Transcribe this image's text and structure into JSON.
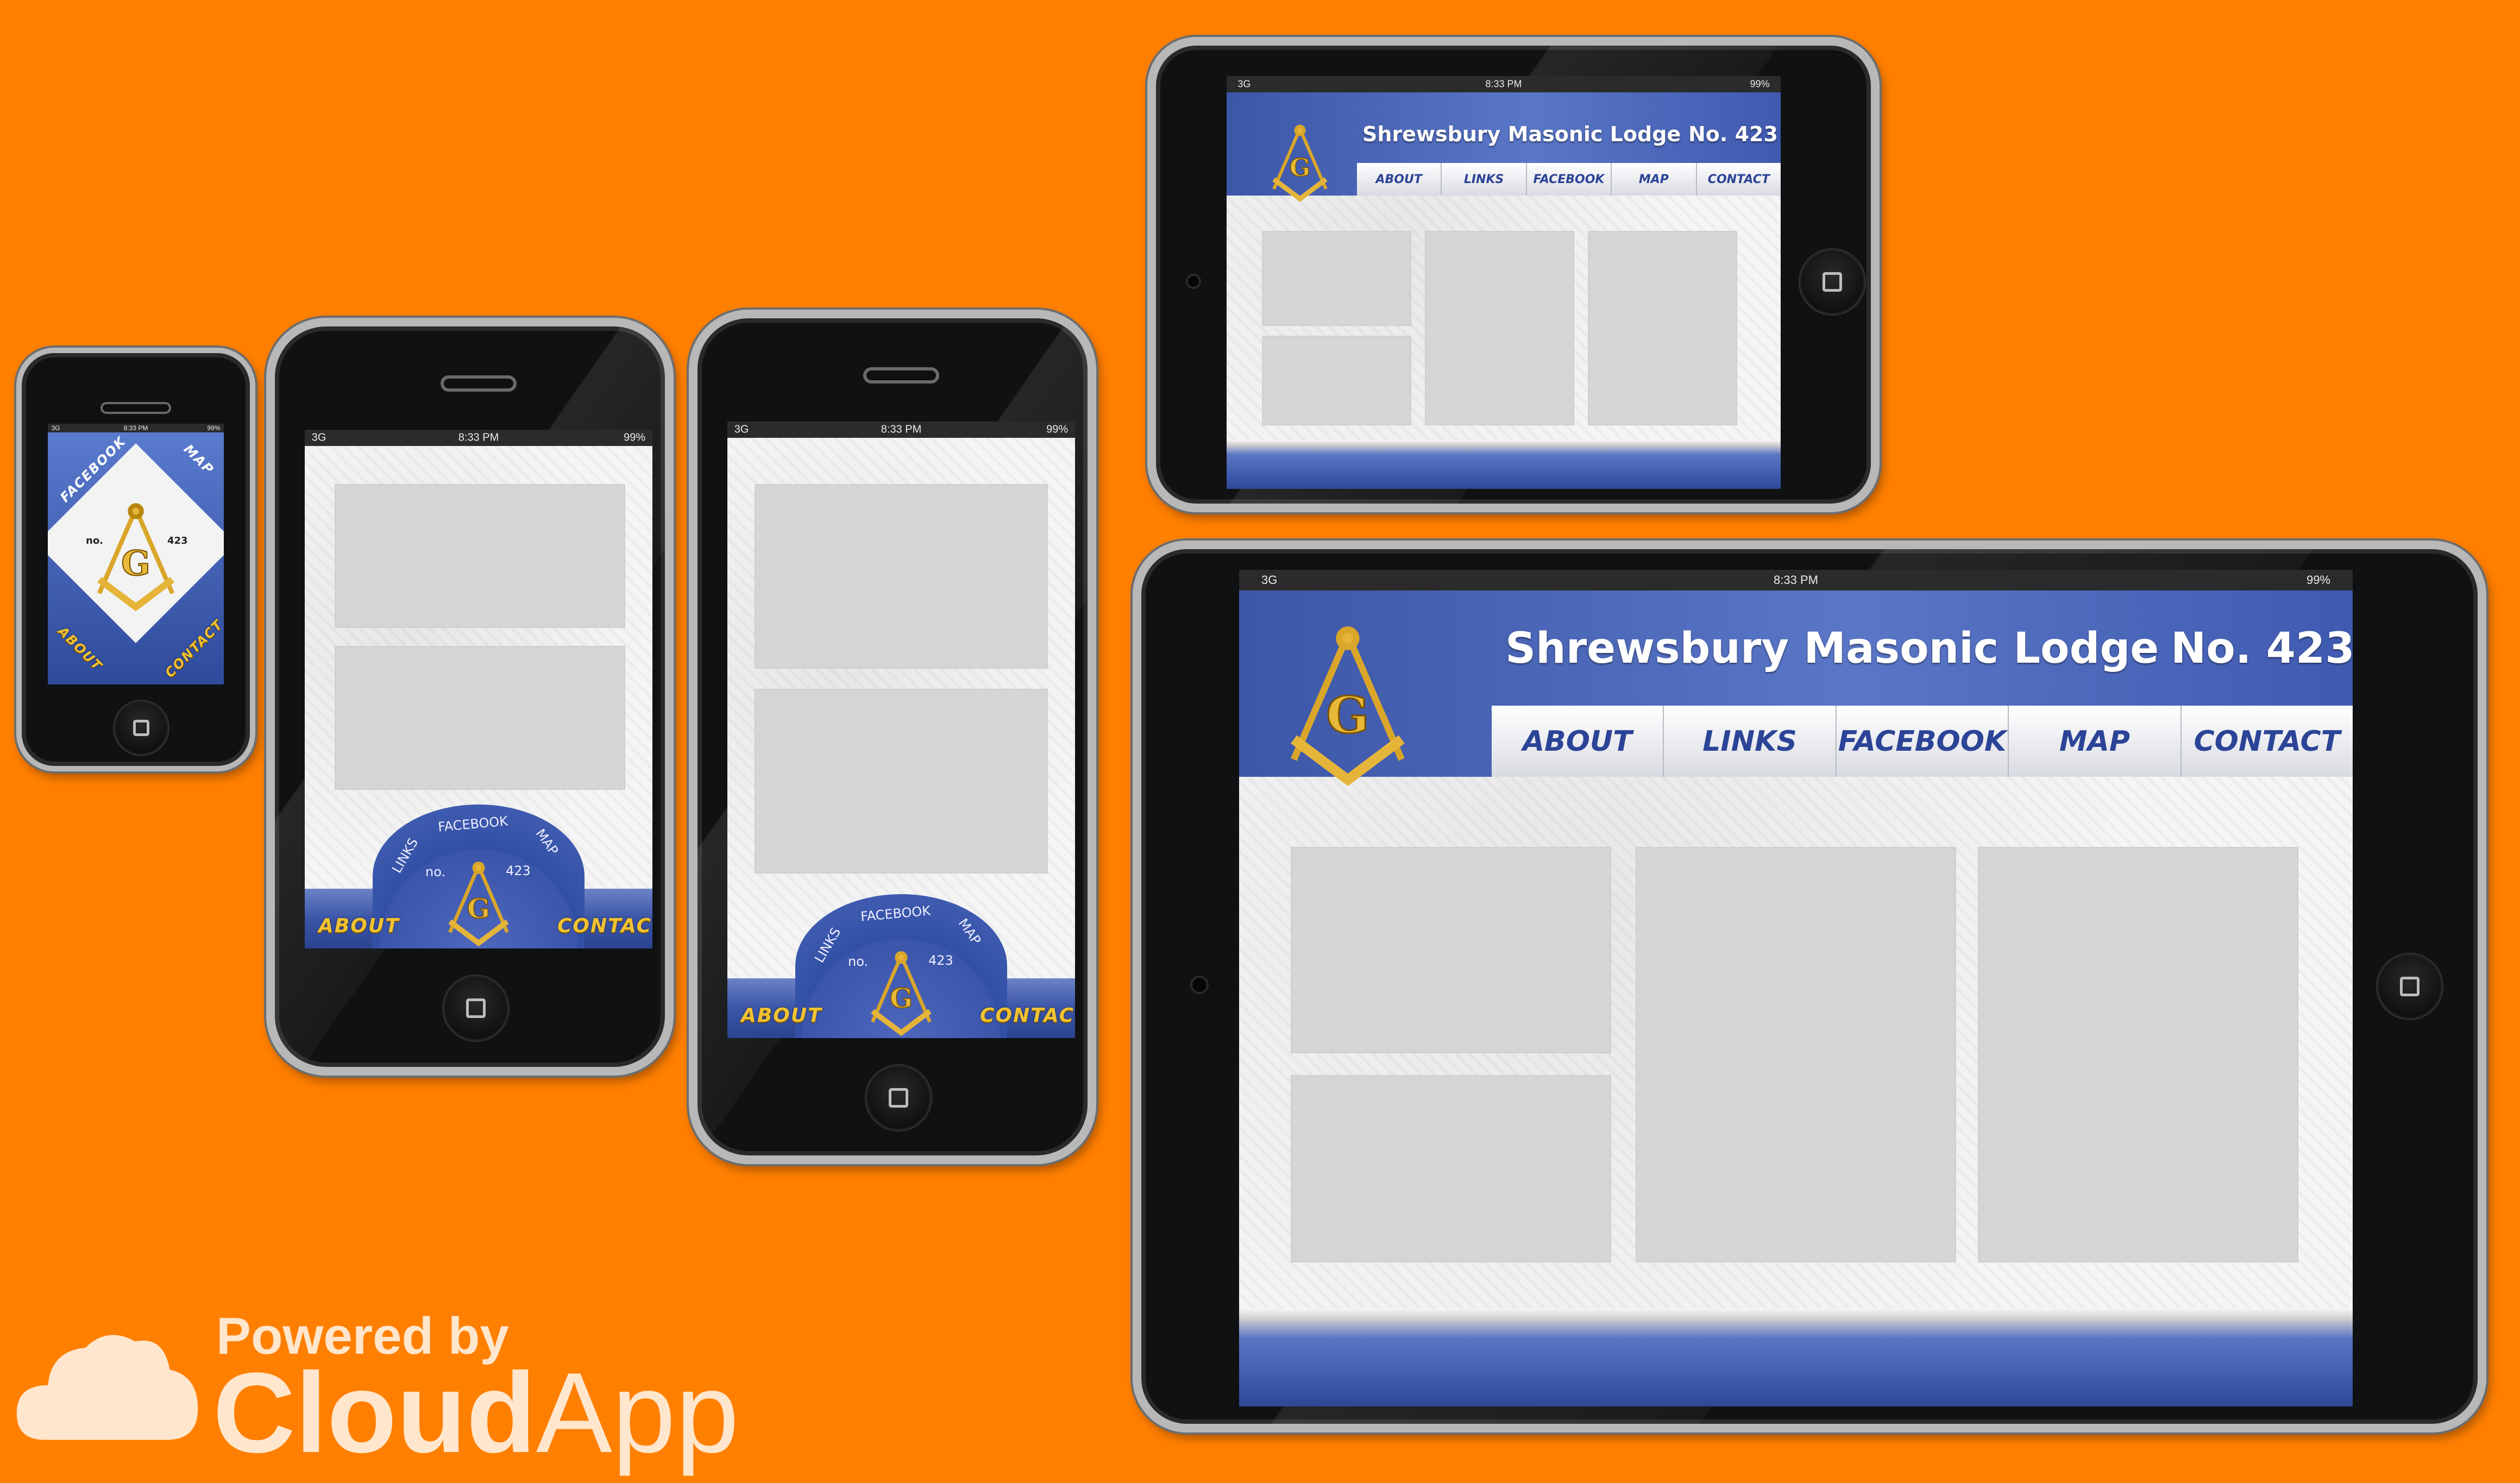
{
  "status": {
    "signal": "3G",
    "time": "8:33 PM",
    "battery": "99%"
  },
  "lodge": {
    "name": "Shrewsbury Masonic Lodge",
    "number": "No. 423",
    "emblem_no": "no.",
    "emblem_num": "423",
    "emblem_letter": "G"
  },
  "nav": [
    "ABOUT",
    "LINKS",
    "FACEBOOK",
    "MAP",
    "CONTACT"
  ],
  "semi_menu": {
    "left": "ABOUT",
    "right": "CONTACT",
    "arc": [
      "LINKS",
      "FACEBOOK",
      "MAP"
    ]
  },
  "small_phone": {
    "corners": [
      "FACEBOOK",
      "MAP",
      "ABOUT",
      "CONTACT"
    ]
  },
  "branding": {
    "powered_by": "Powered by",
    "cloud": "Cloud",
    "app": "App"
  },
  "colors": {
    "background": "#ff7f00",
    "brand_blue": "#3b55a8",
    "gold": "#f1c232"
  },
  "icons": [
    "home-button-icon",
    "cloud-logo-icon",
    "square-compass-emblem-icon",
    "battery-icon",
    "signal-icon"
  ]
}
